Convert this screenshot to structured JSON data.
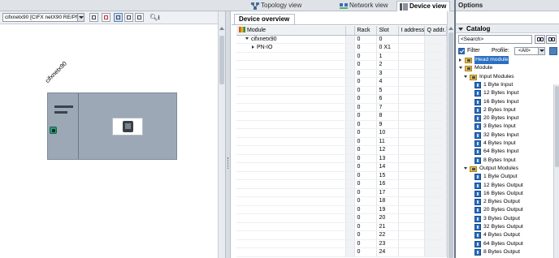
{
  "view_tabs": [
    {
      "label": "Topology view",
      "active": false
    },
    {
      "label": "Network view",
      "active": false
    },
    {
      "label": "Device view",
      "active": true
    }
  ],
  "left_pane": {
    "device_selector": "cifxnetx90 [CIFX netX90 RE/PN",
    "device_label": "cifxnetx90"
  },
  "device_overview": {
    "tab_label": "Device overview",
    "columns": [
      "Module",
      "Rack",
      "Slot",
      "I address",
      "Q addr..."
    ],
    "rows": [
      {
        "module": "cifxnetx90",
        "rack": "0",
        "slot": "0",
        "indent": 1,
        "expander": "down"
      },
      {
        "module": "PN-IO",
        "rack": "0",
        "slot": "0 X1",
        "indent": 2,
        "expander": "right"
      },
      {
        "module": "",
        "rack": "0",
        "slot": "1"
      },
      {
        "module": "",
        "rack": "0",
        "slot": "2"
      },
      {
        "module": "",
        "rack": "0",
        "slot": "3"
      },
      {
        "module": "",
        "rack": "0",
        "slot": "4"
      },
      {
        "module": "",
        "rack": "0",
        "slot": "5"
      },
      {
        "module": "",
        "rack": "0",
        "slot": "6"
      },
      {
        "module": "",
        "rack": "0",
        "slot": "7"
      },
      {
        "module": "",
        "rack": "0",
        "slot": "8"
      },
      {
        "module": "",
        "rack": "0",
        "slot": "9"
      },
      {
        "module": "",
        "rack": "0",
        "slot": "10"
      },
      {
        "module": "",
        "rack": "0",
        "slot": "11"
      },
      {
        "module": "",
        "rack": "0",
        "slot": "12"
      },
      {
        "module": "",
        "rack": "0",
        "slot": "13"
      },
      {
        "module": "",
        "rack": "0",
        "slot": "14"
      },
      {
        "module": "",
        "rack": "0",
        "slot": "15"
      },
      {
        "module": "",
        "rack": "0",
        "slot": "16"
      },
      {
        "module": "",
        "rack": "0",
        "slot": "17"
      },
      {
        "module": "",
        "rack": "0",
        "slot": "18"
      },
      {
        "module": "",
        "rack": "0",
        "slot": "19"
      },
      {
        "module": "",
        "rack": "0",
        "slot": "20"
      },
      {
        "module": "",
        "rack": "0",
        "slot": "21"
      },
      {
        "module": "",
        "rack": "0",
        "slot": "22"
      },
      {
        "module": "",
        "rack": "0",
        "slot": "23"
      },
      {
        "module": "",
        "rack": "0",
        "slot": "24"
      }
    ]
  },
  "right_panel": {
    "options_title": "Options",
    "catalog_title": "Catalog",
    "search_placeholder": "<Search>",
    "filter_label": "Filter",
    "profile_label": "Profile:",
    "profile_value": "<All>",
    "tree": [
      {
        "label": "Head module",
        "type": "folder",
        "expander": "right",
        "indent": 1,
        "highlight": true
      },
      {
        "label": "Module",
        "type": "folder",
        "expander": "down",
        "indent": 1
      },
      {
        "label": "Input Modules",
        "type": "folder",
        "expander": "down",
        "indent": 2
      },
      {
        "label": "1 Byte Input",
        "type": "module",
        "indent": 3
      },
      {
        "label": "12 Bytes Input",
        "type": "module",
        "indent": 3
      },
      {
        "label": "16 Bytes Input",
        "type": "module",
        "indent": 3
      },
      {
        "label": "2 Bytes Input",
        "type": "module",
        "indent": 3
      },
      {
        "label": "20 Bytes Input",
        "type": "module",
        "indent": 3
      },
      {
        "label": "3 Bytes Input",
        "type": "module",
        "indent": 3
      },
      {
        "label": "32 Bytes Input",
        "type": "module",
        "indent": 3
      },
      {
        "label": "4 Bytes Input",
        "type": "module",
        "indent": 3
      },
      {
        "label": "64 Bytes Input",
        "type": "module",
        "indent": 3
      },
      {
        "label": "8 Bytes Input",
        "type": "module",
        "indent": 3
      },
      {
        "label": "Output Modules",
        "type": "folder",
        "expander": "down",
        "indent": 2
      },
      {
        "label": "1 Byte Output",
        "type": "module",
        "indent": 3
      },
      {
        "label": "12 Bytes Output",
        "type": "module",
        "indent": 3
      },
      {
        "label": "16 Bytes Output",
        "type": "module",
        "indent": 3
      },
      {
        "label": "2 Bytes Output",
        "type": "module",
        "indent": 3
      },
      {
        "label": "20 Bytes Output",
        "type": "module",
        "indent": 3
      },
      {
        "label": "3 Bytes Output",
        "type": "module",
        "indent": 3
      },
      {
        "label": "32 Bytes Output",
        "type": "module",
        "indent": 3
      },
      {
        "label": "4 Bytes Output",
        "type": "module",
        "indent": 3
      },
      {
        "label": "64 Bytes Output",
        "type": "module",
        "indent": 3
      },
      {
        "label": "8 Bytes Output",
        "type": "module",
        "indent": 3
      }
    ]
  }
}
